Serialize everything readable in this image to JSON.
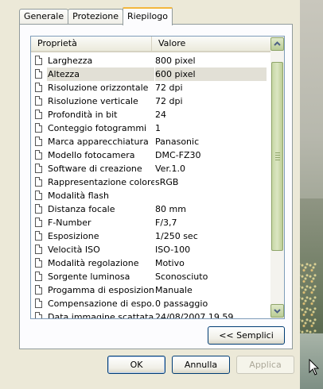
{
  "tabs": [
    {
      "label": "Generale"
    },
    {
      "label": "Protezione"
    },
    {
      "label": "Riepilogo"
    }
  ],
  "columns": {
    "property": "Proprietà",
    "value": "Valore"
  },
  "rows": [
    {
      "name": "Larghezza",
      "value": "800 pixel"
    },
    {
      "name": "Altezza",
      "value": "600 pixel"
    },
    {
      "name": "Risoluzione orizzontale",
      "value": "72 dpi"
    },
    {
      "name": "Risoluzione verticale",
      "value": "72 dpi"
    },
    {
      "name": "Profondità in bit",
      "value": "24"
    },
    {
      "name": "Conteggio fotogrammi",
      "value": "1"
    },
    {
      "name": "Marca apparecchiatura",
      "value": "Panasonic"
    },
    {
      "name": "Modello fotocamera",
      "value": "DMC-FZ30"
    },
    {
      "name": "Software di creazione",
      "value": "Ver.1.0"
    },
    {
      "name": "Rappresentazione colore",
      "value": "sRGB"
    },
    {
      "name": "Modalità flash",
      "value": ""
    },
    {
      "name": "Distanza focale",
      "value": "80 mm"
    },
    {
      "name": "F-Number",
      "value": "F/3,7"
    },
    {
      "name": "Esposizione",
      "value": "1/250 sec"
    },
    {
      "name": "Velocità ISO",
      "value": "ISO-100"
    },
    {
      "name": "Modalità regolazione",
      "value": "Motivo"
    },
    {
      "name": "Sorgente luminosa",
      "value": "Sconosciuto"
    },
    {
      "name": "Progamma di esposizione",
      "value": "Manuale"
    },
    {
      "name": "Compensazione di espo...",
      "value": "0 passaggio"
    },
    {
      "name": "Data immagine scattata",
      "value": "24/08/2007 19.59"
    }
  ],
  "buttons": {
    "simple": "<< Semplici",
    "ok": "OK",
    "cancel": "Annulla",
    "apply": "Applica"
  },
  "colors": {
    "tab_accent": "#f3b73c",
    "scrollbar": "#c7d7a5",
    "button_border": "#003c74",
    "selected_row": "#e2e0d6"
  }
}
